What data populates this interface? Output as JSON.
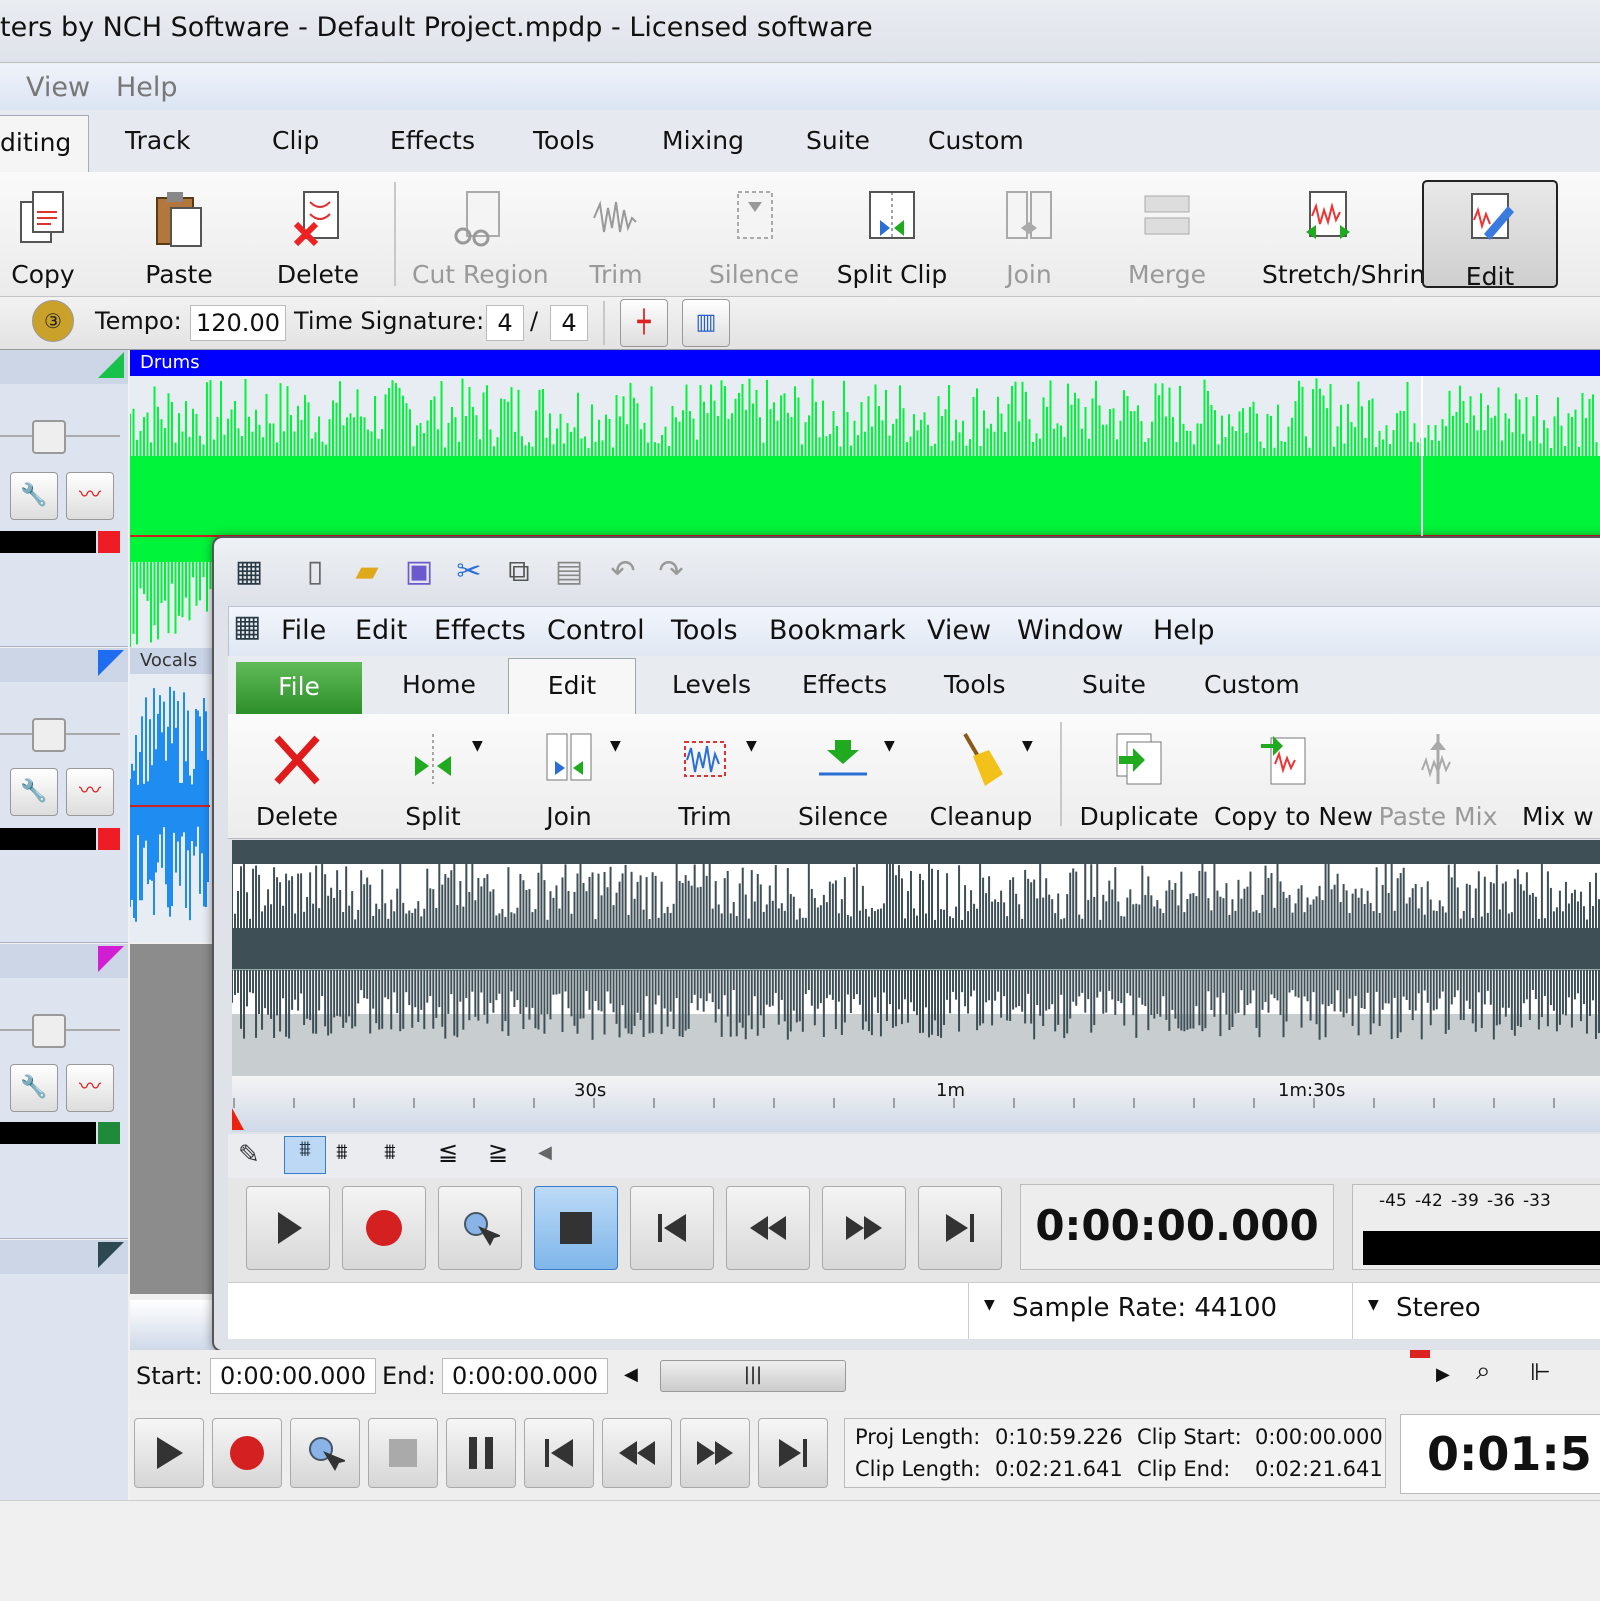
{
  "window": {
    "title": "ters by NCH Software - Default Project.mpdp - Licensed software"
  },
  "menu": [
    "View",
    "Help"
  ],
  "ribbon_tabs": {
    "active": "diting",
    "items": [
      "Track",
      "Clip",
      "Effects",
      "Tools",
      "Mixing",
      "Suite",
      "Custom"
    ]
  },
  "ribbon_buttons": {
    "copy": "Copy",
    "paste": "Paste",
    "delete": "Delete",
    "cut_region": "Cut Region",
    "trim": "Trim",
    "silence": "Silence",
    "split_clip": "Split Clip",
    "join": "Join",
    "merge": "Merge",
    "stretch": "Stretch/Shrink",
    "edit": "Edit"
  },
  "tempo": {
    "label": "Tempo:",
    "value": "120.00",
    "sig_label": "Time Signature:",
    "num": "4",
    "slash": "/",
    "den": "4"
  },
  "tracks": {
    "drums": "Drums",
    "vocals": "Vocals"
  },
  "colors": {
    "drums_wave": "#00f43a",
    "drums_bar": "#0000ff",
    "vocals_wave": "#1e8cf0",
    "inner_wave": "#3e4f56",
    "file_tab": "#3aa334"
  },
  "inner": {
    "menu": [
      "File",
      "Edit",
      "Effects",
      "Control",
      "Tools",
      "Bookmark",
      "View",
      "Window",
      "Help"
    ],
    "tabs": {
      "file": "File",
      "home": "Home",
      "edit": "Edit",
      "levels": "Levels",
      "effects": "Effects",
      "tools": "Tools",
      "suite": "Suite",
      "custom": "Custom"
    },
    "buttons": {
      "delete": "Delete",
      "split": "Split",
      "join": "Join",
      "trim": "Trim",
      "silence": "Silence",
      "cleanup": "Cleanup",
      "duplicate": "Duplicate",
      "copy_to_new": "Copy to New",
      "paste_mix": "Paste Mix",
      "mix": "Mix w"
    },
    "ruler": [
      "30s",
      "1m",
      "1m:30s"
    ],
    "time": "0:00:00.000",
    "meter_scale": [
      "-45",
      "-42",
      "-39",
      "-36",
      "-33"
    ],
    "sample_rate": "Sample Rate: 44100",
    "channels": "Stereo"
  },
  "selection": {
    "start_label": "Start:",
    "start": "0:00:00.000",
    "end_label": "End:",
    "end": "0:00:00.000"
  },
  "info": {
    "proj_length_label": "Proj Length:",
    "proj_length": "0:10:59.226",
    "clip_start_label": "Clip Start:",
    "clip_start": "0:00:00.000",
    "clip_length_label": "Clip Length:",
    "clip_length": "0:02:21.641",
    "clip_end_label": "Clip End:",
    "clip_end": "0:02:21.641"
  },
  "big_time": "0:01:5"
}
